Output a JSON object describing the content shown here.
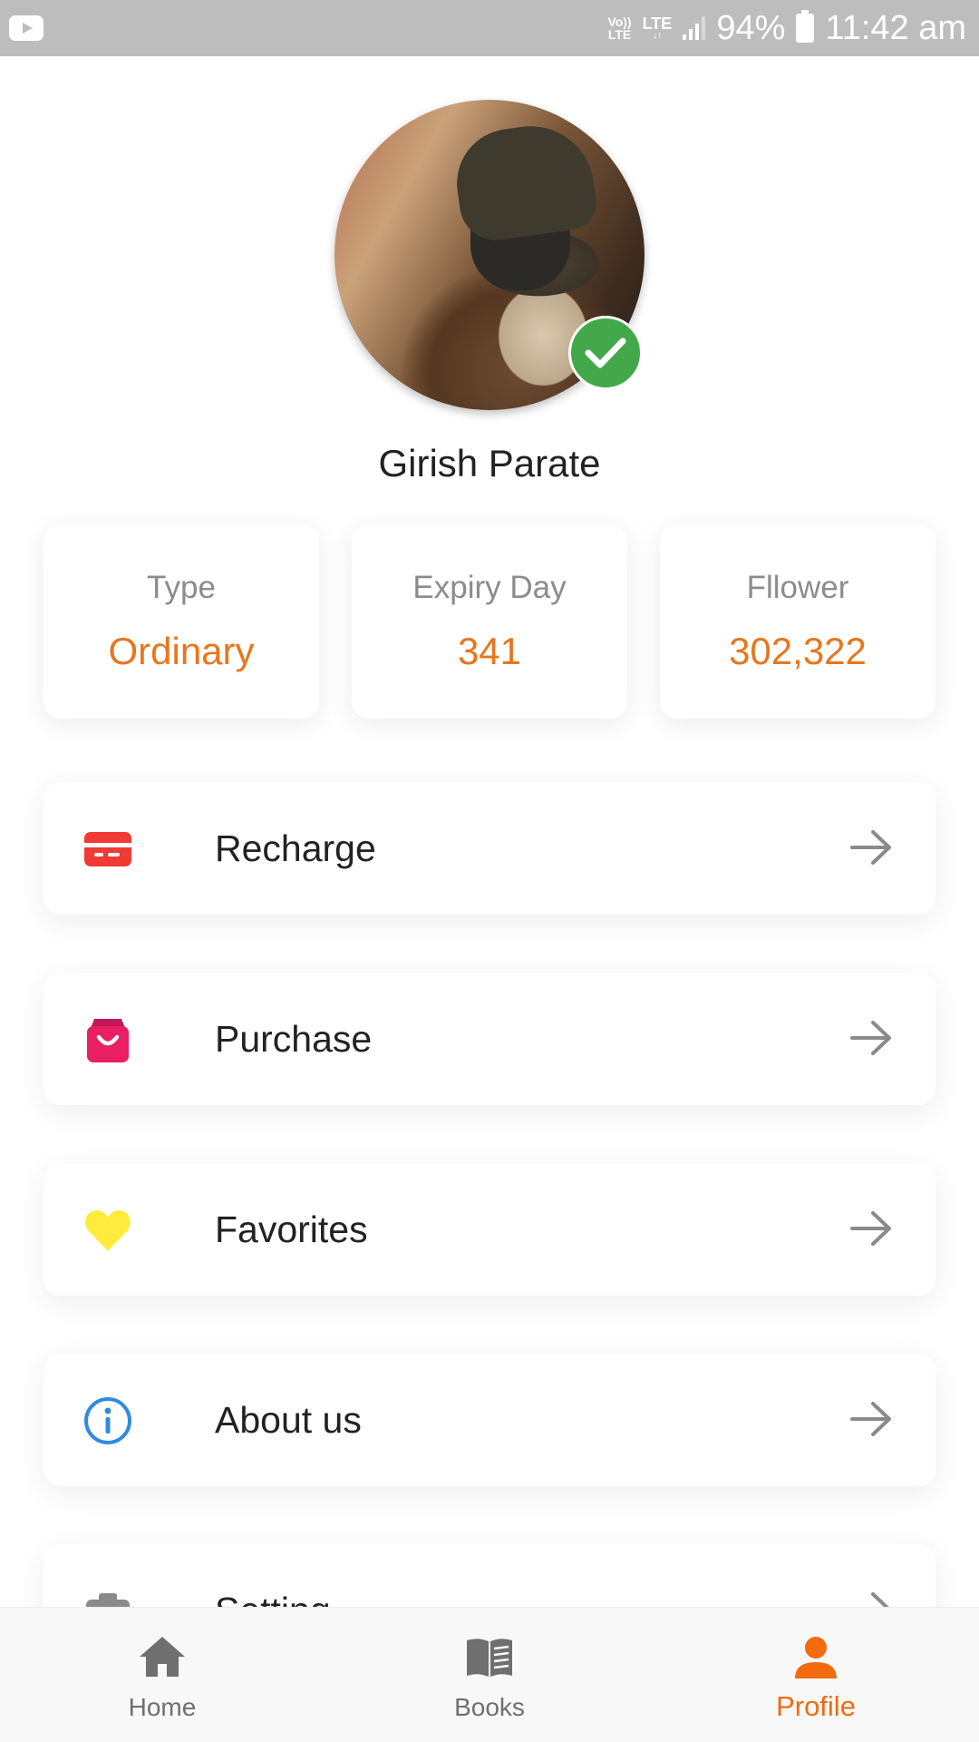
{
  "status_bar": {
    "volte_line1": "Vo))",
    "volte_line2": "LTE",
    "network": "LTE",
    "battery": "94%",
    "time": "11:42 am",
    "icons": [
      "youtube-icon",
      "signal-icon",
      "battery-icon"
    ]
  },
  "profile": {
    "name": "Girish Parate",
    "verified": true,
    "avatar": "user-avatar-photo"
  },
  "stats": [
    {
      "label": "Type",
      "value": "Ordinary"
    },
    {
      "label": "Expiry Day",
      "value": "341"
    },
    {
      "label": "Fllower",
      "value": "302,322"
    }
  ],
  "menu": [
    {
      "label": "Recharge",
      "icon": "card-icon",
      "color": "#ef3b33"
    },
    {
      "label": "Purchase",
      "icon": "shopping-bag-icon",
      "color": "#e91e63"
    },
    {
      "label": "Favorites",
      "icon": "heart-icon",
      "color": "#ffeb3b"
    },
    {
      "label": "About us",
      "icon": "info-icon",
      "color": "#2f8be0"
    },
    {
      "label": "Setting",
      "icon": "camera-icon",
      "color": "#8a8a8a"
    }
  ],
  "bottom_nav": [
    {
      "label": "Home",
      "icon": "home-icon",
      "active": false
    },
    {
      "label": "Books",
      "icon": "book-icon",
      "active": false
    },
    {
      "label": "Profile",
      "icon": "person-icon",
      "active": true
    }
  ],
  "colors": {
    "accent": "#e8761c",
    "active_nav": "#f26b0f",
    "verified": "#43a84a",
    "status_bar": "#bdbdbd"
  }
}
